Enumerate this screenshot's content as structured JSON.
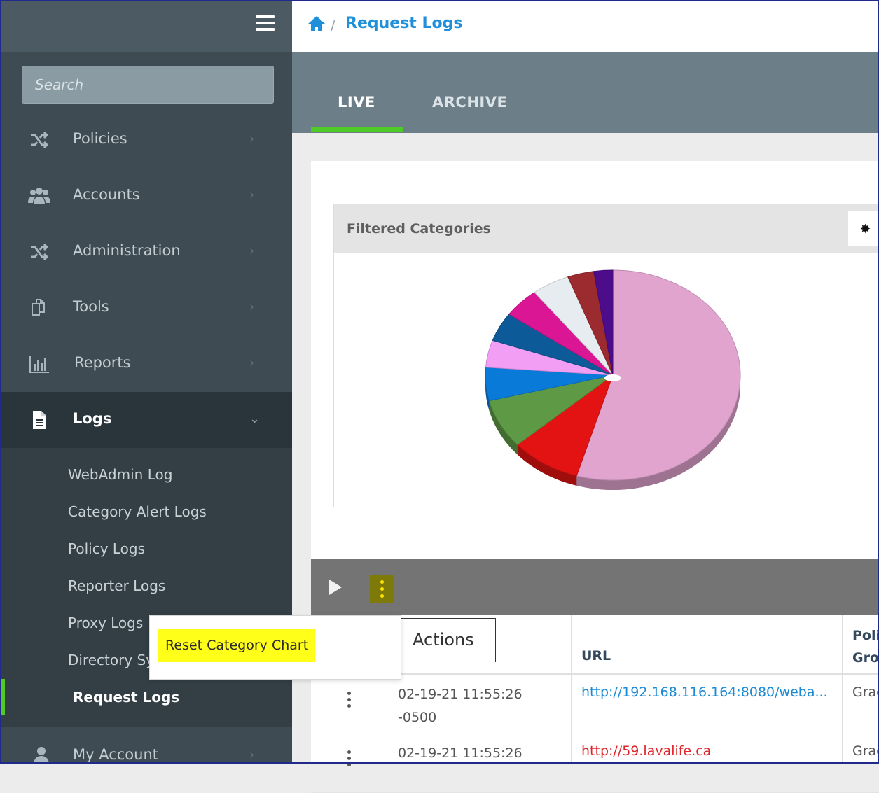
{
  "sidebar": {
    "search_placeholder": "Search",
    "items": [
      {
        "label": "Policies",
        "icon": "shuffle-icon"
      },
      {
        "label": "Accounts",
        "icon": "users-icon"
      },
      {
        "label": "Administration",
        "icon": "shuffle-icon"
      },
      {
        "label": "Tools",
        "icon": "copy-icon"
      },
      {
        "label": "Reports",
        "icon": "bar-chart-icon"
      },
      {
        "label": "Logs",
        "icon": "file-icon"
      }
    ],
    "sub_items": [
      "WebAdmin Log",
      "Category Alert Logs",
      "Policy Logs",
      "Reporter Logs",
      "Proxy Logs",
      "Directory Sy",
      "Request Logs"
    ],
    "bottom_item": {
      "label": "My Account",
      "icon": "user-icon"
    }
  },
  "breadcrumb": {
    "separator": "/",
    "title": "Request Logs"
  },
  "tabs": [
    {
      "label": "LIVE",
      "active": true
    },
    {
      "label": "ARCHIVE",
      "active": false
    }
  ],
  "chart_card": {
    "title": "Filtered Categories",
    "settings_icon": "gear-icon"
  },
  "chart_data": {
    "type": "pie",
    "values": [
      52.3,
      8.5,
      7.3,
      4.9,
      4.0,
      4.3,
      4.4,
      4.6,
      3.2,
      2.3
    ],
    "colors": [
      "#e1a4cf",
      "#e31313",
      "#5e9a45",
      "#0a7ad9",
      "#f29ef4",
      "#0d5a99",
      "#db1694",
      "#e6ecef",
      "#9b2b2e",
      "#4d0d8a"
    ]
  },
  "context_menu": {
    "item": "Reset Category Chart"
  },
  "actions_tooltip": "Actions",
  "table": {
    "headers": {
      "url": "URL",
      "policy_line1": "Poli",
      "policy_line2": "Gro"
    },
    "rows": [
      {
        "time_line1": "02-19-21 11:55:26",
        "time_line2": "-0500",
        "url": "http://192.168.116.164:8080/weba...",
        "url_color": "#1a8ad4",
        "policy": "Grad"
      },
      {
        "time_line1": "02-19-21 11:55:26",
        "time_line2": "",
        "url": "http://59.lavalife.ca",
        "url_color": "#e0252a",
        "policy": "Grad"
      }
    ]
  }
}
